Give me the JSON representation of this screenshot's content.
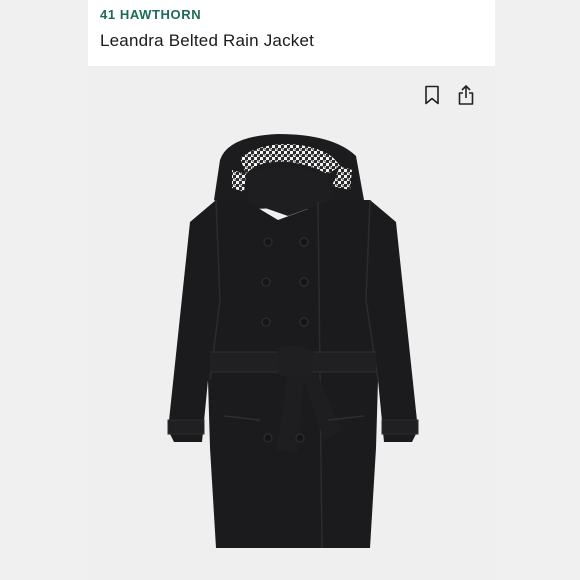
{
  "product": {
    "brand": "41 HAWTHORN",
    "title": "Leandra Belted Rain Jacket"
  },
  "icons": {
    "bookmark": "bookmark-icon",
    "share": "share-icon"
  },
  "colors": {
    "brand": "#1d6b57",
    "background": "#f0f0f1",
    "jacket": "#1b1b1d"
  }
}
